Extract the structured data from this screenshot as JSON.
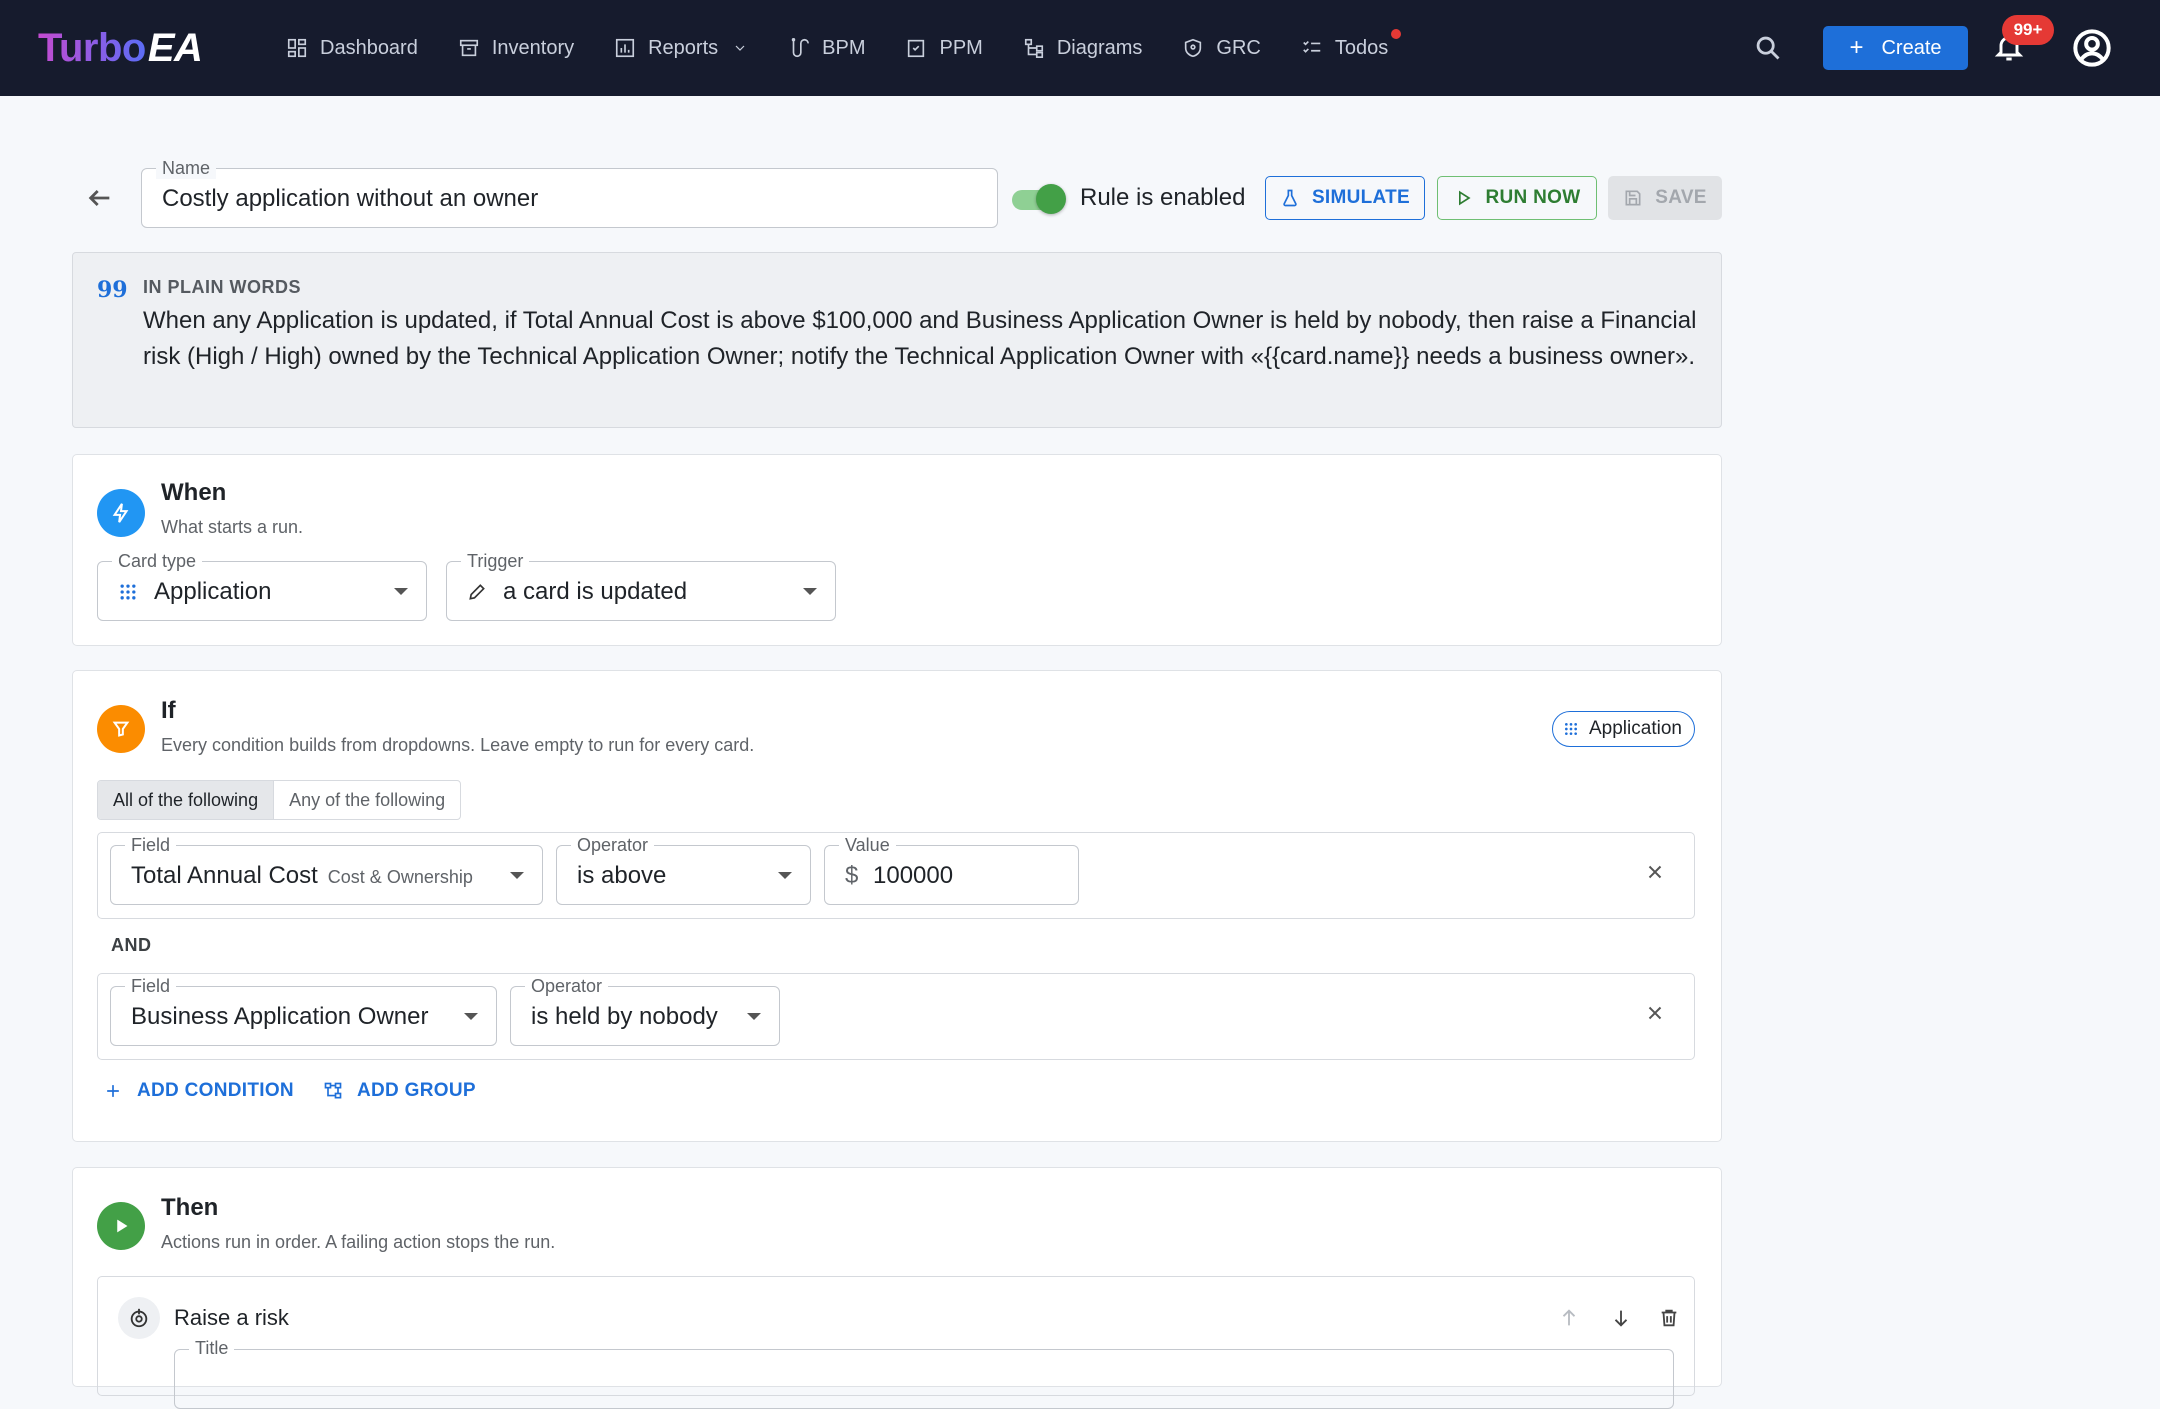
{
  "app": {
    "logo_main": "Turbo",
    "logo_suffix": "EA"
  },
  "nav": {
    "items": [
      {
        "label": "Dashboard",
        "icon": "dashboard-icon"
      },
      {
        "label": "Inventory",
        "icon": "archive-icon"
      },
      {
        "label": "Reports",
        "icon": "bar-chart-icon",
        "has_dropdown": true
      },
      {
        "label": "BPM",
        "icon": "route-icon"
      },
      {
        "label": "PPM",
        "icon": "clipboard-icon"
      },
      {
        "label": "Diagrams",
        "icon": "sitemap-icon"
      },
      {
        "label": "GRC",
        "icon": "shield-icon"
      },
      {
        "label": "Todos",
        "icon": "checklist-icon",
        "has_dot": true
      }
    ],
    "create_label": "Create",
    "notification_badge": "99+"
  },
  "header": {
    "name_label": "Name",
    "name_value": "Costly application without an owner",
    "toggle_label": "Rule is enabled",
    "toggle_on": true,
    "simulate_label": "SIMULATE",
    "run_now_label": "RUN NOW",
    "save_label": "SAVE",
    "save_disabled": true
  },
  "plain_words": {
    "title": "IN PLAIN WORDS",
    "text": "When any Application is updated, if Total Annual Cost is above $100,000 and Business Application Owner is held by nobody, then raise a Financial risk (High / High) owned by the Technical Application Owner; notify the Technical Application Owner with «{{card.name}} needs a business owner»."
  },
  "when": {
    "title": "When",
    "subtitle": "What starts a run.",
    "card_type_label": "Card type",
    "card_type_value": "Application",
    "trigger_label": "Trigger",
    "trigger_value": "a card is updated"
  },
  "if": {
    "title": "If",
    "subtitle": "Every condition builds from dropdowns. Leave empty to run for every card.",
    "chip_label": "Application",
    "mode_all": "All of the following",
    "mode_any": "Any of the following",
    "mode_selected": "All of the following",
    "conditions": [
      {
        "field_label": "Field",
        "field_value": "Total Annual Cost",
        "field_group": "Cost & Ownership",
        "operator_label": "Operator",
        "operator_value": "is above",
        "value_label": "Value",
        "value_prefix": "$",
        "value": "100000"
      },
      {
        "field_label": "Field",
        "field_value": "Business Application Owner",
        "operator_label": "Operator",
        "operator_value": "is held by nobody"
      }
    ],
    "joiner": "AND",
    "add_condition_label": "ADD CONDITION",
    "add_group_label": "ADD GROUP"
  },
  "then": {
    "title": "Then",
    "subtitle": "Actions run in order. A failing action stops the run.",
    "actions": [
      {
        "title": "Raise a risk",
        "title_field_label": "Title"
      }
    ]
  },
  "colors": {
    "topbar": "#161b2d",
    "primary": "#1e6fd9",
    "success": "#43a047",
    "warning": "#fb8c00",
    "danger": "#e53935"
  }
}
